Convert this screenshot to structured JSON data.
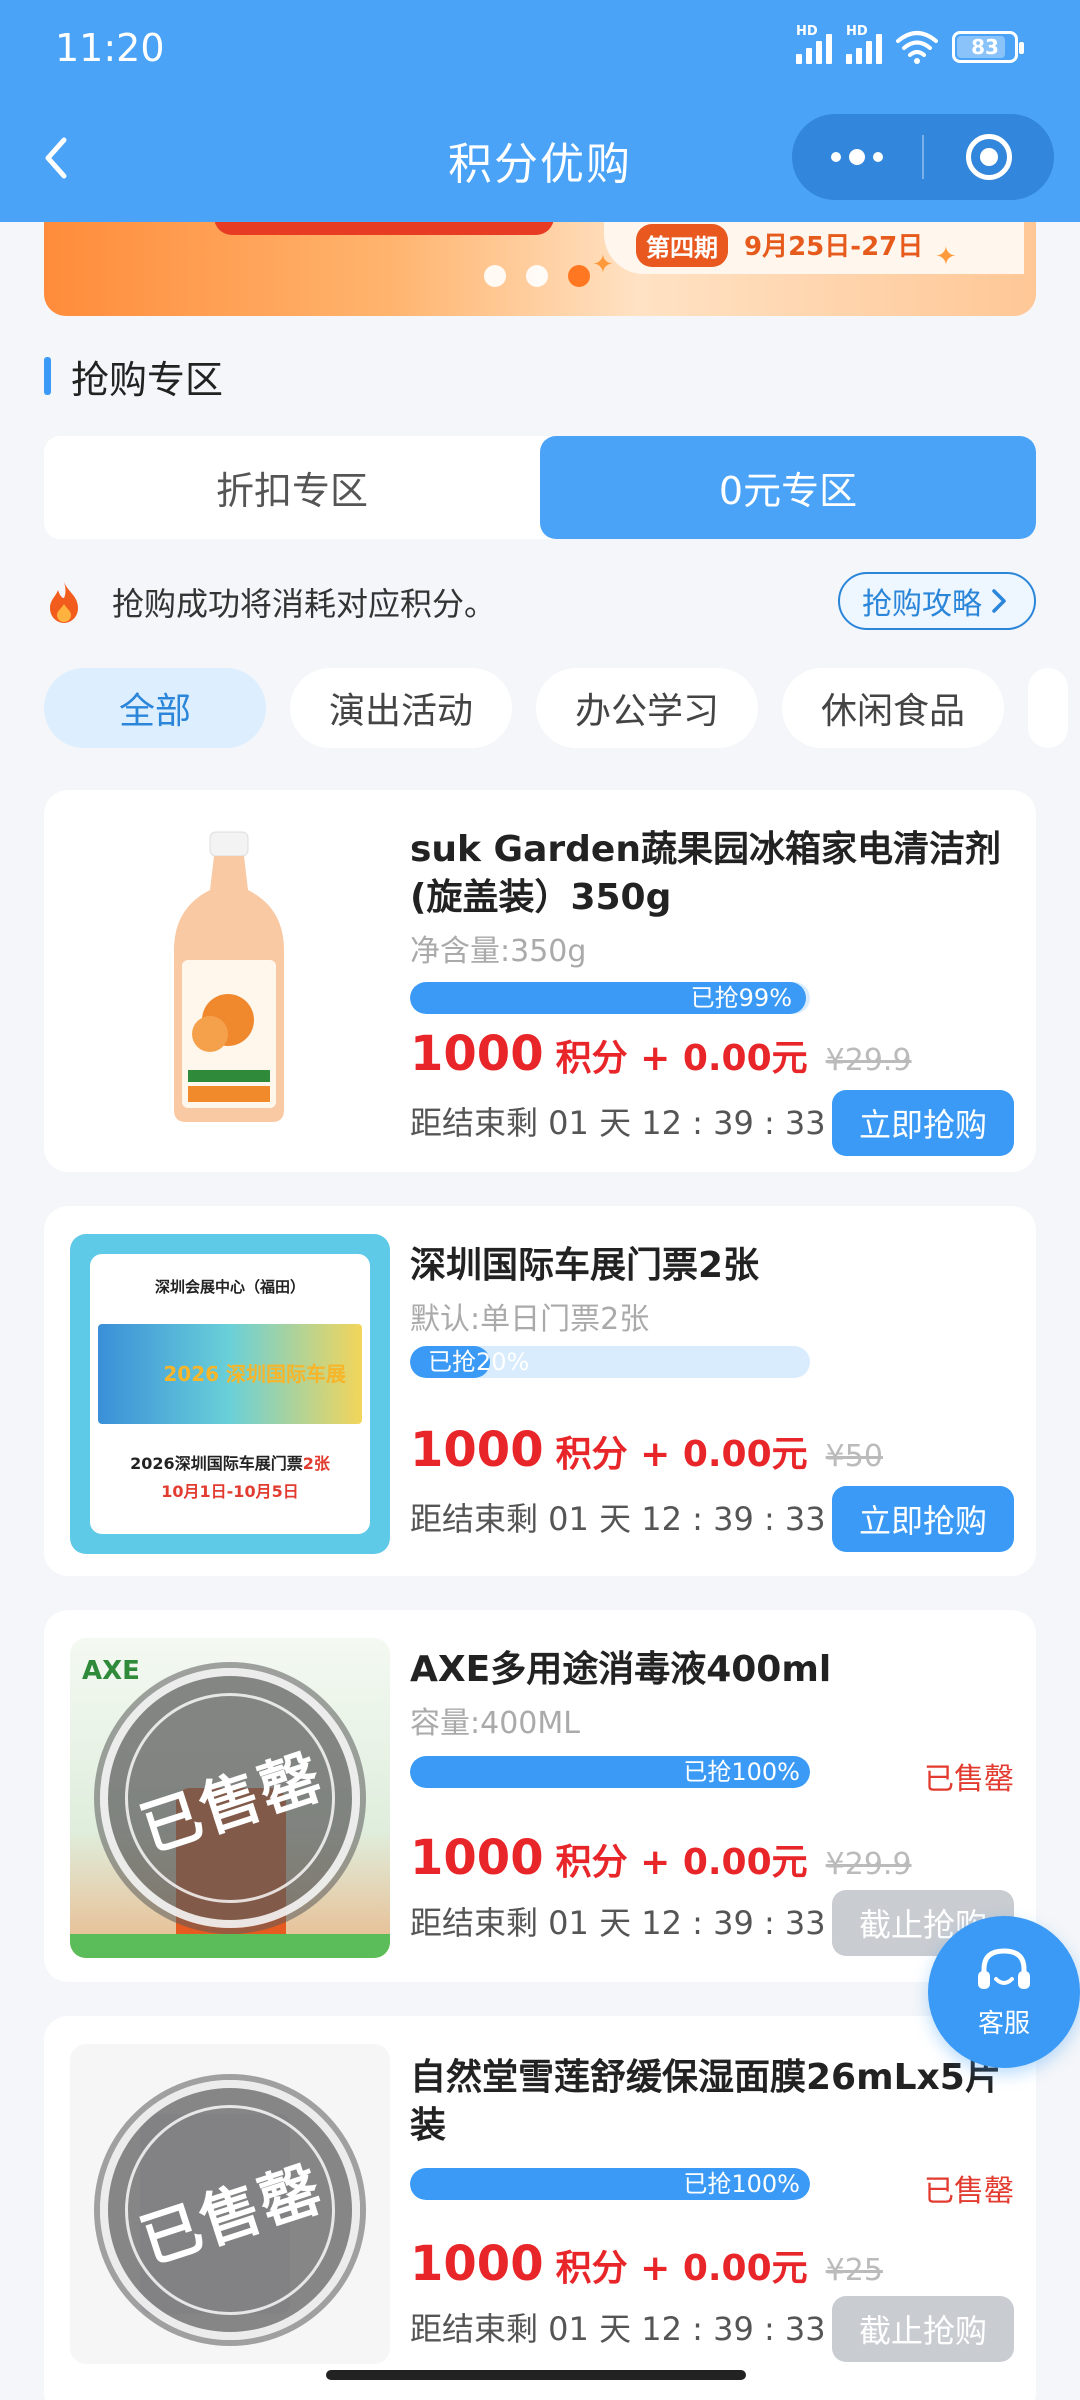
{
  "status_bar": {
    "time": "11:20",
    "signal1_label": "HD",
    "signal2_label": "HD",
    "battery": "83"
  },
  "nav": {
    "title": "积分优购"
  },
  "banner": {
    "issue": "第四期",
    "date": "9月25日-27日"
  },
  "section": {
    "title": "抢购专区"
  },
  "zone_tabs": [
    {
      "label": "折扣专区",
      "active": false
    },
    {
      "label": "0元专区",
      "active": true
    }
  ],
  "notice": {
    "text": "抢购成功将消耗对应积分。",
    "guide_label": "抢购攻略"
  },
  "categories": [
    {
      "label": "全部",
      "active": true
    },
    {
      "label": "演出活动",
      "active": false
    },
    {
      "label": "办公学习",
      "active": false
    },
    {
      "label": "休闲食品",
      "active": false
    }
  ],
  "products": [
    {
      "name": "suk Garden蔬果园冰箱家电清洁剂(旋盖装）350g",
      "spec": "净含量:350g",
      "progress_label": "已抢99%",
      "progress": 0.99,
      "points": "1000",
      "plus_cash": "积分 + 0.00元",
      "original_price": "¥29.9",
      "countdown": "距结束剩 01 天 12 : 39 : 33",
      "button": "立即抢购",
      "sold_out": false
    },
    {
      "name": "深圳国际车展门票2张",
      "spec": "默认:单日门票2张",
      "progress_label": "已抢20%",
      "progress": 0.2,
      "points": "1000",
      "plus_cash": "积分 + 0.00元",
      "original_price": "¥50",
      "countdown": "距结束剩 01 天 12 : 39 : 33",
      "button": "立即抢购",
      "sold_out": false,
      "ticket": {
        "venue": "深圳会展中心（福田）",
        "title_a": "2026深圳国际车展门票",
        "title_b": "2张",
        "dates": "10月1日-10月5日",
        "poster_text": "2026 深圳国际车展"
      }
    },
    {
      "name": "AXE多用途消毒液400ml",
      "spec": "容量:400ML",
      "progress_label": "已抢100%",
      "progress": 1.0,
      "sold_tag": "已售罄",
      "points": "1000",
      "plus_cash": "积分 + 0.00元",
      "original_price": "¥29.9",
      "countdown": "距结束剩 01 天 12 : 39 : 33",
      "button": "截止抢购",
      "sold_out": true,
      "stamp": "已售罄",
      "brand": "AXE"
    },
    {
      "name": "自然堂雪莲舒缓保湿面膜26mLx5片装",
      "spec": "",
      "progress_label": "已抢100%",
      "progress": 1.0,
      "sold_tag": "已售罄",
      "points": "1000",
      "plus_cash": "积分 + 0.00元",
      "original_price": "¥25",
      "countdown": "距结束剩 01 天 12 : 39 : 33",
      "button": "截止抢购",
      "sold_out": true,
      "stamp": "已售罄"
    }
  ],
  "service": {
    "label": "客服"
  }
}
